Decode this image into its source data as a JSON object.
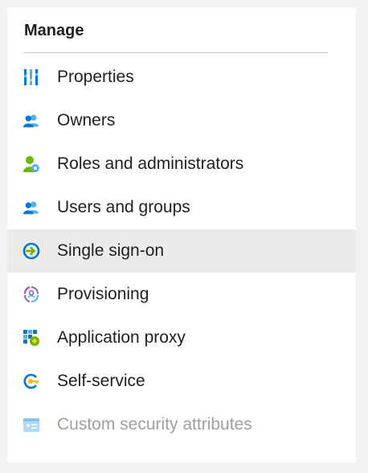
{
  "section": {
    "title": "Manage"
  },
  "items": [
    {
      "label": "Properties",
      "icon": "properties-icon"
    },
    {
      "label": "Owners",
      "icon": "owners-icon"
    },
    {
      "label": "Roles and administrators",
      "icon": "roles-icon"
    },
    {
      "label": "Users and groups",
      "icon": "users-groups-icon"
    },
    {
      "label": "Single sign-on",
      "icon": "sso-icon",
      "selected": true
    },
    {
      "label": "Provisioning",
      "icon": "provisioning-icon"
    },
    {
      "label": "Application proxy",
      "icon": "app-proxy-icon"
    },
    {
      "label": "Self-service",
      "icon": "self-service-icon"
    },
    {
      "label": "Custom security attributes",
      "icon": "custom-attributes-icon",
      "disabled": true
    }
  ],
  "colors": {
    "selected_bg": "#edebe9",
    "accent": "#0078d4",
    "disabled_text": "#a19f9d"
  }
}
